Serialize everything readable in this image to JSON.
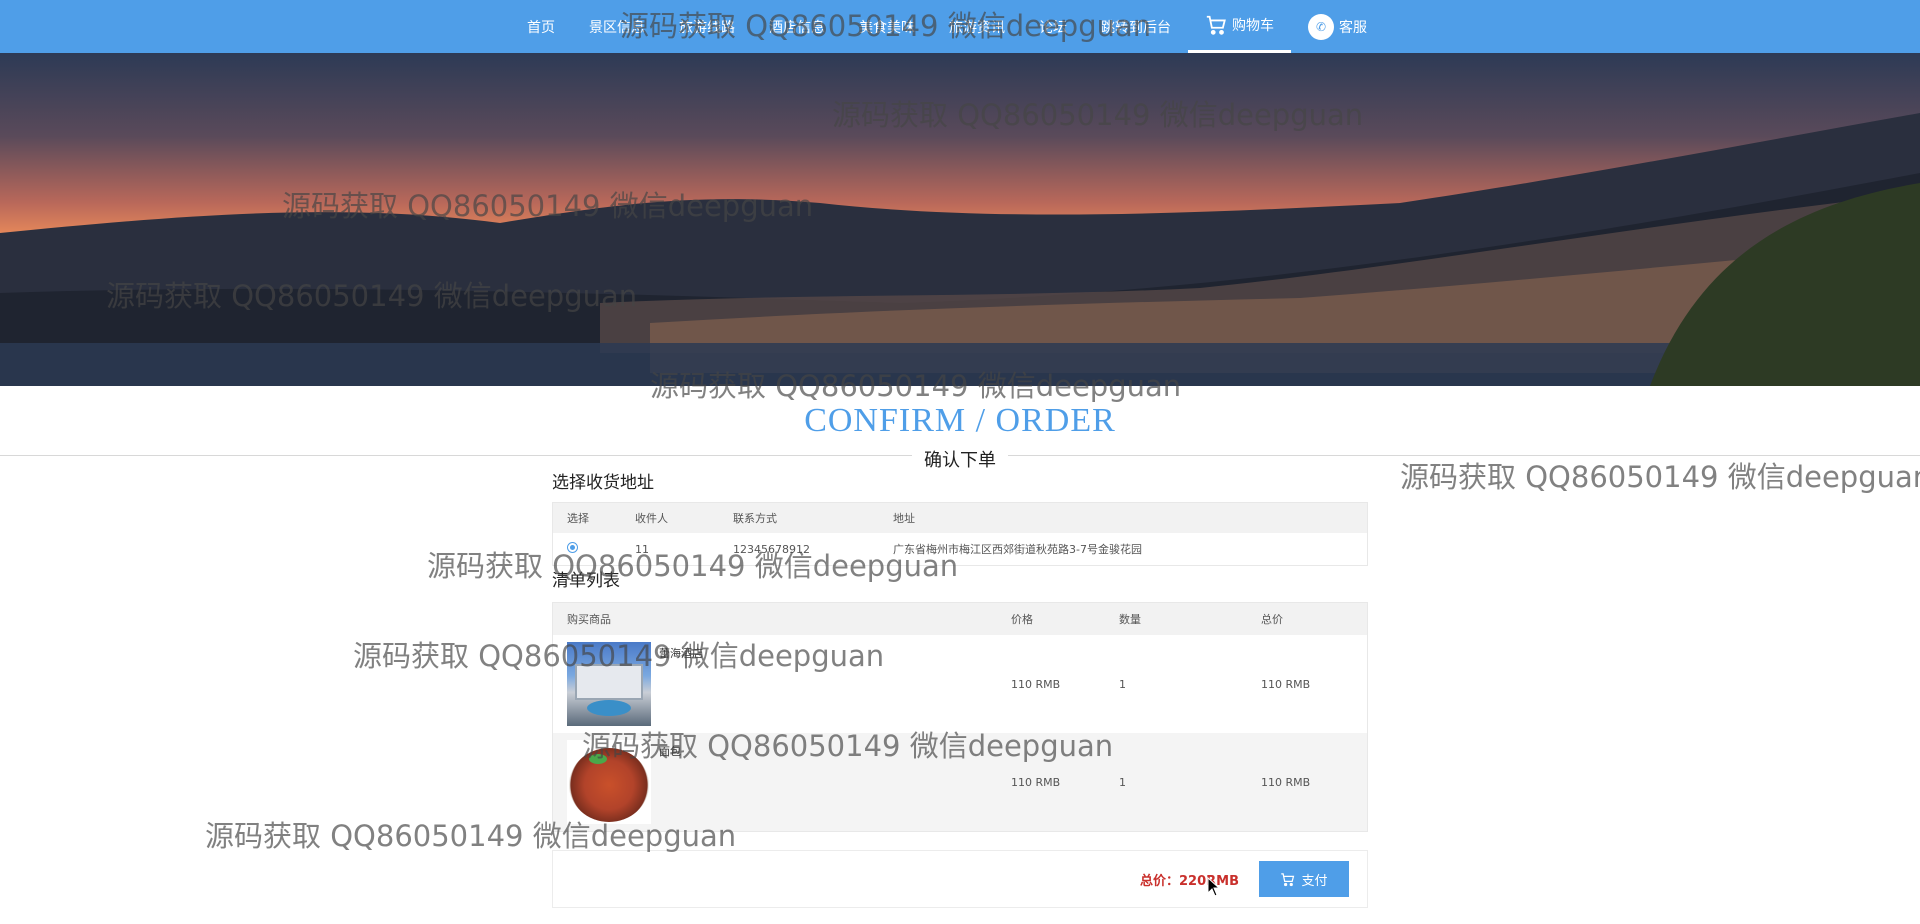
{
  "nav": {
    "items": [
      {
        "label": "首页"
      },
      {
        "label": "景区信息"
      },
      {
        "label": "旅游线路"
      },
      {
        "label": "酒店信息"
      },
      {
        "label": "美食美味"
      },
      {
        "label": "旅游资讯"
      },
      {
        "label": "论坛"
      },
      {
        "label": "跳转到后台"
      },
      {
        "label": "购物车",
        "icon": "cart-icon",
        "active": true
      },
      {
        "label": "客服",
        "icon": "chat-icon"
      }
    ]
  },
  "page": {
    "title_en": "CONFIRM / ORDER",
    "title_cn": "确认下单"
  },
  "address": {
    "section_title": "选择收货地址",
    "headers": {
      "select": "选择",
      "recipient": "收件人",
      "phone": "联系方式",
      "address": "地址"
    },
    "rows": [
      {
        "selected": true,
        "recipient": "11",
        "phone": "12345678912",
        "address": "广东省梅州市梅江区西郊街道秋苑路3-7号金骏花园"
      }
    ]
  },
  "order_list": {
    "section_title": "清单列表",
    "headers": {
      "item": "购买商品",
      "price": "价格",
      "quantity": "数量",
      "total": "总价"
    },
    "rows": [
      {
        "name": "蕾海酒店",
        "thumb": "hotel-image",
        "price": "110 RMB",
        "quantity": "1",
        "total": "110 RMB"
      },
      {
        "name": "面包",
        "thumb": "food-image",
        "price": "110 RMB",
        "quantity": "1",
        "total": "110 RMB"
      }
    ]
  },
  "checkout": {
    "total_label": "总价：220RMB",
    "pay_label": "支付",
    "pay_icon": "cart-icon"
  },
  "watermark": "源码获取 QQ86050149 微信deepguan",
  "colors": {
    "accent": "#4f9ee8",
    "total": "#c9302c"
  }
}
